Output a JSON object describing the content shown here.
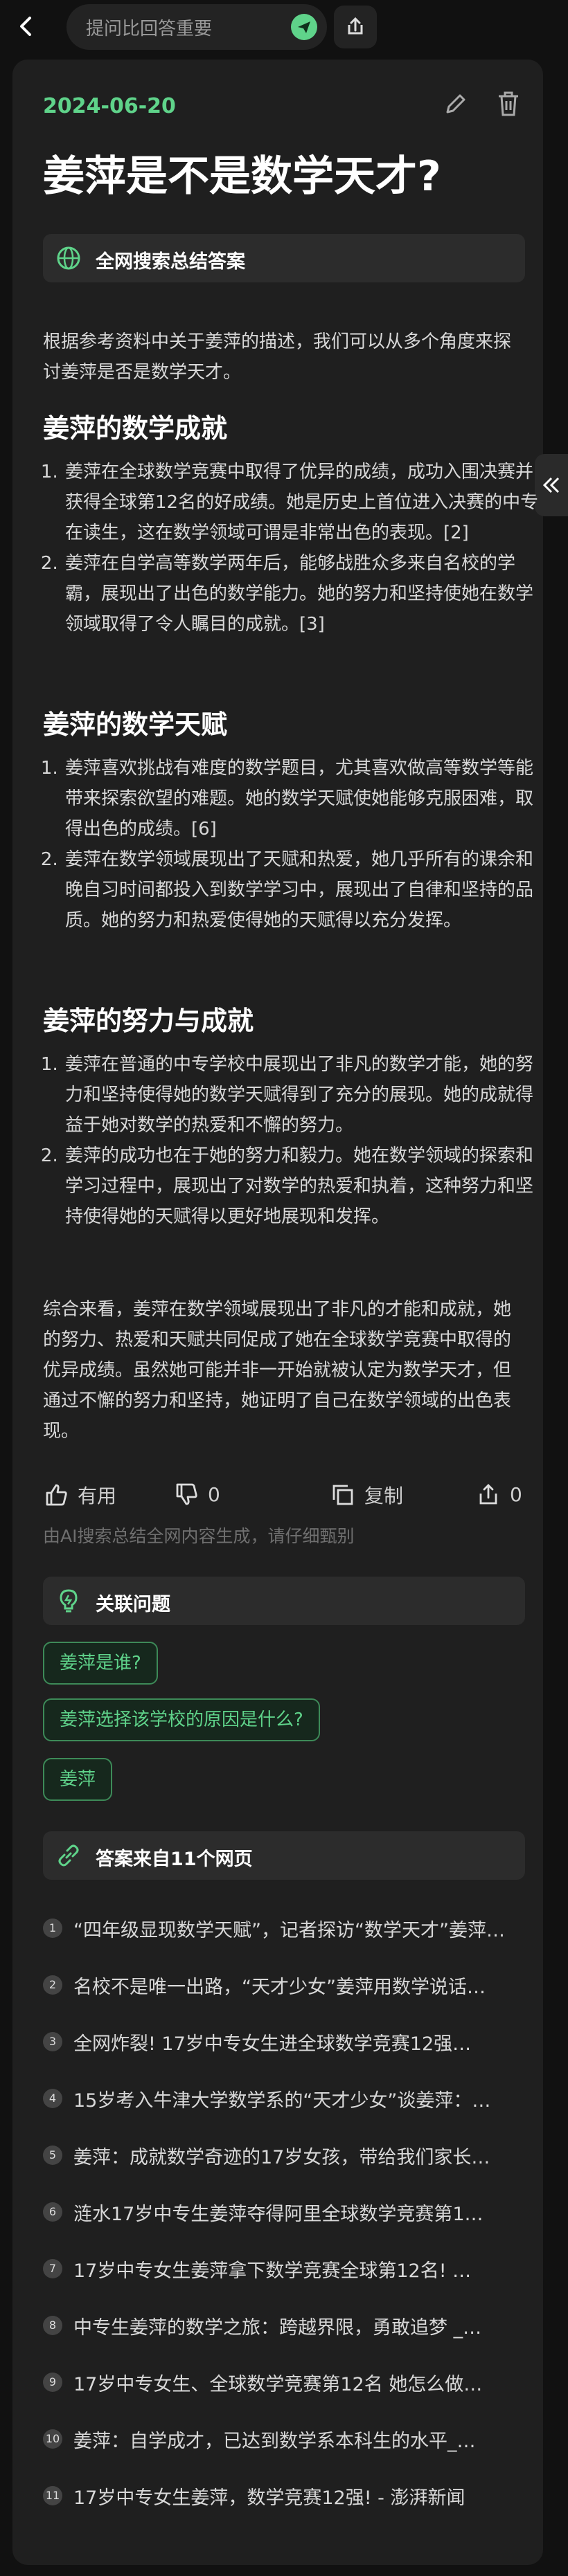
{
  "header": {
    "ask_placeholder": "提问比回答重要"
  },
  "article": {
    "date": "2024-06-20",
    "title": "姜萍是不是数学天才?",
    "summary_label": "全网搜索总结答案",
    "intro": "根据参考资料中关于姜萍的描述，我们可以从多个角度来探讨姜萍是否是数学天才。",
    "sections": [
      {
        "heading": "姜萍的数学成就",
        "items": [
          "姜萍在全球数学竞赛中取得了优异的成绩，成功入围决赛并获得全球第12名的好成绩。她是历史上首位进入决赛的中专在读生，这在数学领域可谓是非常出色的表现。[2]",
          "姜萍在自学高等数学两年后，能够战胜众多来自名校的学霸，展现出了出色的数学能力。她的努力和坚持使她在数学领域取得了令人瞩目的成就。[3]"
        ]
      },
      {
        "heading": "姜萍的数学天赋",
        "items": [
          "姜萍喜欢挑战有难度的数学题目，尤其喜欢做高等数学等能带来探索欲望的难题。她的数学天赋使她能够克服困难，取得出色的成绩。[6]",
          "姜萍在数学领域展现出了天赋和热爱，她几乎所有的课余和晚自习时间都投入到数学学习中，展现出了自律和坚持的品质。她的努力和热爱使得她的天赋得以充分发挥。"
        ]
      },
      {
        "heading": "姜萍的努力与成就",
        "items": [
          "姜萍在普通的中专学校中展现出了非凡的数学才能，她的努力和坚持使得她的数学天赋得到了充分的展现。她的成就得益于她对数学的热爱和不懈的努力。",
          "姜萍的成功也在于她的努力和毅力。她在数学领域的探索和学习过程中，展现出了对数学的热爱和执着，这种努力和坚持使得她的天赋得以更好地展现和发挥。"
        ]
      }
    ],
    "conclusion": "综合来看，姜萍在数学领域展现出了非凡的才能和成就，她的努力、热爱和天赋共同促成了她在全球数学竞赛中取得的优异成绩。虽然她可能并非一开始就被认定为数学天才，但通过不懈的努力和坚持，她证明了自己在数学领域的出色表现。"
  },
  "actions": {
    "useful": "有用",
    "dislike_count": "0",
    "copy": "复制",
    "share_count": "0",
    "disclaimer": "由AI搜索总结全网内容生成，请仔细甄别"
  },
  "related": {
    "label": "关联问题",
    "chips": [
      "姜萍是谁?",
      "姜萍选择该学校的原因是什么?",
      "姜萍"
    ]
  },
  "sources": {
    "label": "答案来自11个网页",
    "items": [
      {
        "n": "1",
        "t": "“四年级显现数学天赋”，记者探访“数学天才”姜萍…"
      },
      {
        "n": "2",
        "t": "名校不是唯一出路，“天才少女”姜萍用数学说话…"
      },
      {
        "n": "3",
        "t": "全网炸裂! 17岁中专女生进全球数学竞赛12强…"
      },
      {
        "n": "4",
        "t": "15岁考入牛津大学数学系的“天才少女”谈姜萍：…"
      },
      {
        "n": "5",
        "t": "姜萍：成就数学奇迹的17岁女孩，带给我们家长…"
      },
      {
        "n": "6",
        "t": "涟水17岁中专生姜萍夺得阿里全球数学竞赛第1…"
      },
      {
        "n": "7",
        "t": "17岁中专女生姜萍拿下数学竞赛全球第12名! …"
      },
      {
        "n": "8",
        "t": "中专生姜萍的数学之旅：跨越界限，勇敢追梦 _…"
      },
      {
        "n": "9",
        "t": "17岁中专女生、全球数学竞赛第12名 她怎么做…"
      },
      {
        "n": "10",
        "t": "姜萍：自学成才，已达到数学系本科生的水平_…"
      },
      {
        "n": "11",
        "t": "17岁中专女生姜萍，数学竞赛12强! - 澎湃新闻"
      }
    ]
  },
  "colors": {
    "accent": "#5fd38a",
    "background": "#111111",
    "card": "#1f1f1f"
  }
}
